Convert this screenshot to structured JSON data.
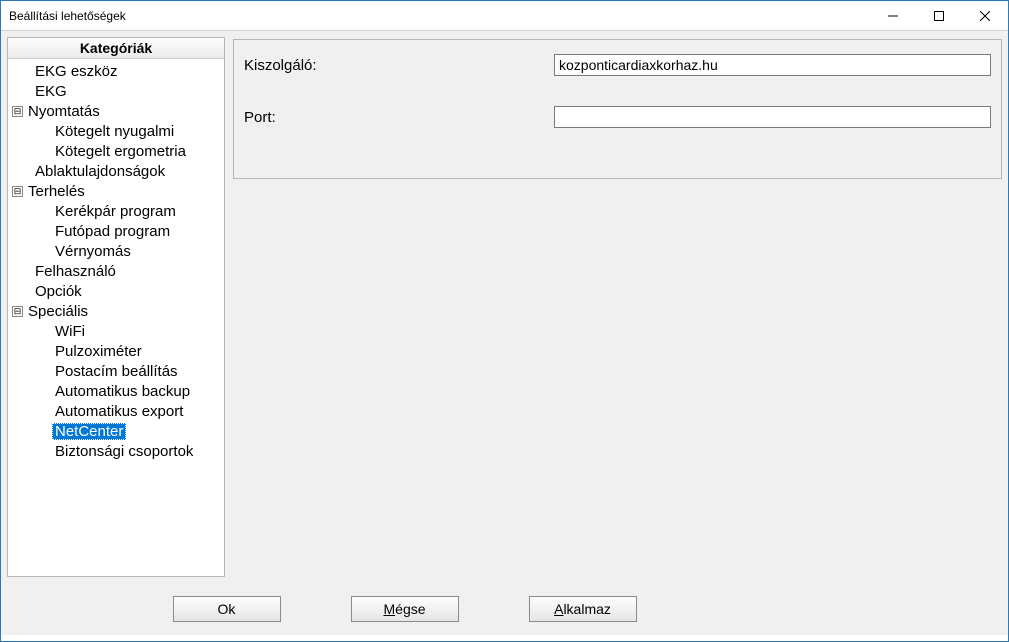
{
  "window": {
    "title": "Beállítási lehetőségek"
  },
  "sidebar": {
    "header": "Kategóriák",
    "items": {
      "ekg_eszkoz": "EKG eszköz",
      "ekg": "EKG",
      "nyomtatas": "Nyomtatás",
      "kotegelt_nyugalmi": "Kötegelt nyugalmi",
      "kotegelt_ergometria": "Kötegelt ergometria",
      "ablaktulajdonsagok": "Ablaktulajdonságok",
      "terheles": "Terhelés",
      "kerekpar": "Kerékpár program",
      "futopad": "Futópad program",
      "vernyomas": "Vérnyomás",
      "felhasznalo": "Felhasználó",
      "opciok": "Opciók",
      "specialis": "Speciális",
      "wifi": "WiFi",
      "pulzoximeter": "Pulzoximéter",
      "postacim": "Postacím beállítás",
      "auto_backup": "Automatikus backup",
      "auto_export": "Automatikus export",
      "netcenter": "NetCenter",
      "biztonsagi": "Biztonsági csoportok"
    }
  },
  "form": {
    "server_label": "Kiszolgáló:",
    "server_value": "kozponticardiaxkorhaz.hu",
    "port_label": "Port:",
    "port_value": ""
  },
  "buttons": {
    "ok": "Ok",
    "cancel_prefix": "M",
    "cancel_suffix": "égse",
    "apply_prefix": "A",
    "apply_suffix": "lkalmaz"
  }
}
